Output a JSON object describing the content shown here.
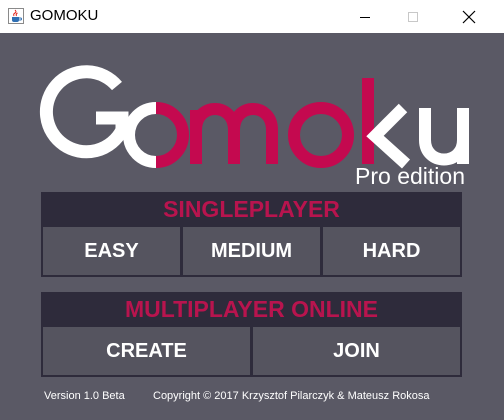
{
  "window": {
    "title": "GOMOKU",
    "controls": {
      "minimize": "minimize-icon",
      "maximize": "maximize-icon",
      "close": "close-icon"
    }
  },
  "logo": {
    "text": "Gomoku",
    "subtitle": "Pro edition",
    "colors": {
      "white": "#ffffff",
      "accent": "#c4094f",
      "subtitle": "#ffffff"
    }
  },
  "singleplayer": {
    "header": "SINGLEPLAYER",
    "buttons": [
      "EASY",
      "MEDIUM",
      "HARD"
    ]
  },
  "multiplayer": {
    "header": "MULTIPLAYER ONLINE",
    "buttons": [
      "CREATE",
      "JOIN"
    ]
  },
  "footer": {
    "version": "Version 1.0 Beta",
    "copyright": "Copyright © 2017 Krzysztof Pilarczyk & Mateusz Rokosa"
  },
  "colors": {
    "background": "#5a5965",
    "panel": "#2e2b3b",
    "accent": "#b8144e",
    "button": "#55545f",
    "text": "#ffffff"
  }
}
